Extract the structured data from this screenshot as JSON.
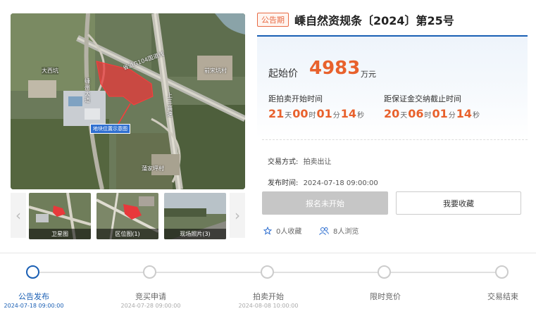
{
  "gallery": {
    "map_labels": {
      "road_top": "省道G104国道线",
      "village_left": "大西坑",
      "village_right": "前宋坑村",
      "road_right": "上三高速",
      "village_bottom": "蒲家坪村",
      "road_left": "嵊州大道",
      "parcel_tag": "地块位置示意图"
    },
    "thumbs": [
      {
        "caption": "卫星图"
      },
      {
        "caption": "区位图(1)"
      },
      {
        "caption": "现场照片(3)"
      }
    ],
    "prev_arrow": "‹",
    "next_arrow": "›"
  },
  "listing": {
    "badge": "公告期",
    "title": "嵊自然资规条〔2024〕第25号",
    "price_label": "起始价",
    "price_value": "4983",
    "price_unit": "万元"
  },
  "countdowns": [
    {
      "label": "距拍卖开始时间",
      "parts": [
        {
          "n": "21",
          "u": "天"
        },
        {
          "n": "00",
          "u": "时"
        },
        {
          "n": "01",
          "u": "分"
        },
        {
          "n": "14",
          "u": "秒"
        }
      ]
    },
    {
      "label": "距保证金交纳截止时间",
      "parts": [
        {
          "n": "20",
          "u": "天"
        },
        {
          "n": "06",
          "u": "时"
        },
        {
          "n": "01",
          "u": "分"
        },
        {
          "n": "14",
          "u": "秒"
        }
      ]
    }
  ],
  "meta": {
    "mode_key": "交易方式:",
    "mode_value": "拍卖出让",
    "publish_key": "发布时间:",
    "publish_value": "2024-07-18 09:00:00"
  },
  "actions": {
    "signup_label": "报名未开始",
    "favorite_label": "我要收藏"
  },
  "stats": {
    "favorites": "0人收藏",
    "views": "8人浏览"
  },
  "colors": {
    "accent": "#e8612c",
    "brand": "#1a5fb4"
  },
  "steps": [
    {
      "label": "公告发布",
      "date": "2024-07-18 09:00:00",
      "active": true
    },
    {
      "label": "竞买申请",
      "date": "2024-07-28 09:00:00",
      "active": false
    },
    {
      "label": "拍卖开始",
      "date": "2024-08-08 10:00:00",
      "active": false
    },
    {
      "label": "限时竞价",
      "date": "",
      "active": false
    },
    {
      "label": "交易结束",
      "date": "",
      "active": false
    }
  ]
}
